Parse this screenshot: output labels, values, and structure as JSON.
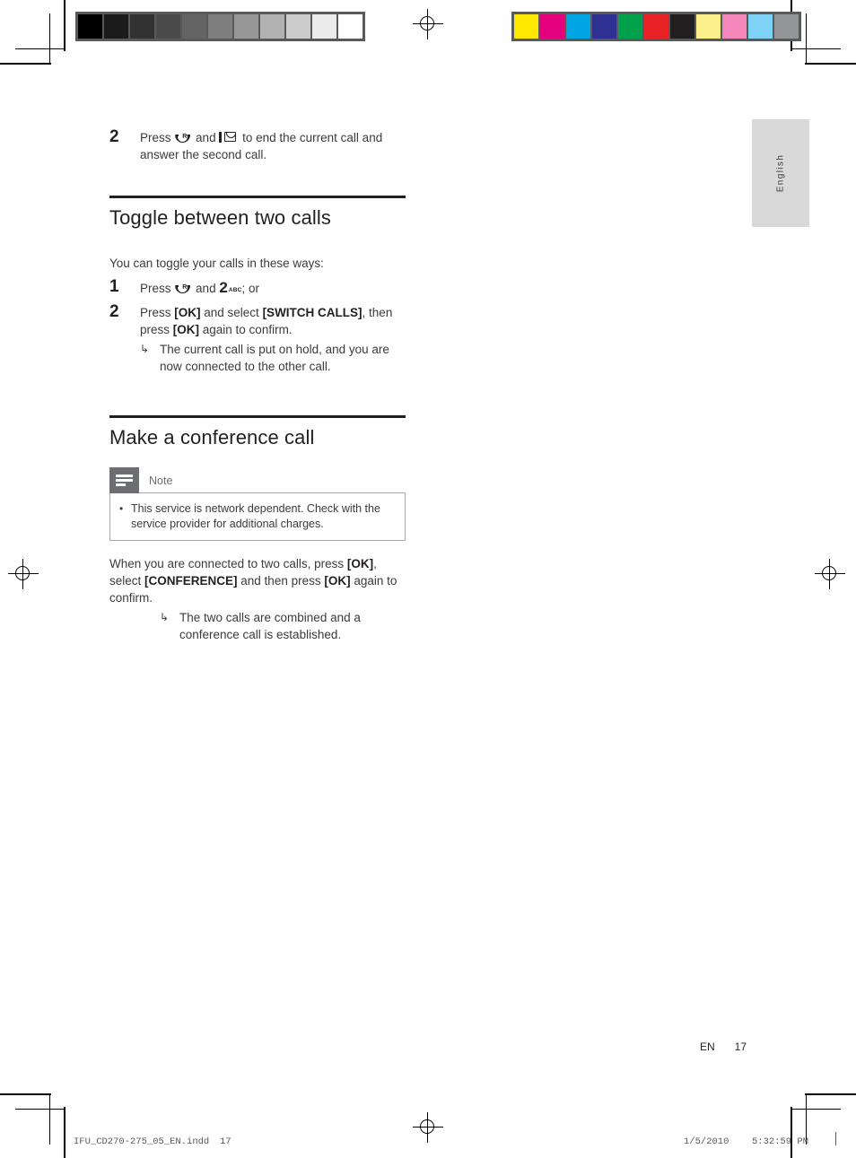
{
  "page": {
    "language_tab": "English",
    "footer": {
      "language_code": "EN",
      "page_number": "17"
    },
    "print_strip": {
      "filename": "IFU_CD270-275_05_EN.indd",
      "page_number": "17",
      "date": "1/5/2010",
      "time": "5:32:59 PM"
    }
  },
  "calibration": {
    "grayscale_label": "grayscale-calibration-bar",
    "color_label": "color-calibration-bar",
    "grayscale_swatches": [
      "#000000",
      "#1c1b1b",
      "#333232",
      "#4c4b4b",
      "#656464",
      "#7f7e7e",
      "#989797",
      "#b3b2b2",
      "#cdcccc",
      "#ebebeb",
      "#ffffff"
    ],
    "color_swatches": [
      "#fee800",
      "#e5007e",
      "#00a5e3",
      "#2e3192",
      "#00a14b",
      "#e92226",
      "#231f20",
      "#fbf08b",
      "#f486bc",
      "#7ed2f5",
      "#939598"
    ]
  },
  "content": {
    "step_continued": {
      "number": "2",
      "text_before": "Press",
      "text_middle": "and",
      "text_after": "to end the current call and answer the second call.",
      "icon_handset": "handset-recall-icon",
      "icon_endcall": "end-call-envelope-icon"
    },
    "section_toggle": {
      "heading": "Toggle between two calls",
      "intro": "You can toggle your calls in these ways:",
      "steps": [
        {
          "number": "1",
          "text_before": "Press",
          "text_middle": "and",
          "key_digit": "2",
          "key_letters": "ABC",
          "text_after": "; or"
        },
        {
          "number": "2",
          "segments": [
            {
              "text": "Press ",
              "bold": false
            },
            {
              "text": "[OK]",
              "bold": true
            },
            {
              "text": " and select ",
              "bold": false
            },
            {
              "text": "[SWITCH CALLS]",
              "bold": true
            },
            {
              "text": ", then press ",
              "bold": false
            },
            {
              "text": "[OK]",
              "bold": true
            },
            {
              "text": " again to confirm.",
              "bold": false
            }
          ],
          "subnote": "The current call is put on hold, and you are now connected to the other call."
        }
      ]
    },
    "section_conference": {
      "heading": "Make a conference call",
      "note": {
        "label": "Note",
        "items": [
          "This service is network dependent. Check with the service provider for additional charges."
        ]
      },
      "body_segments": [
        {
          "text": "When you are connected to two calls, press ",
          "bold": false
        },
        {
          "text": "[OK]",
          "bold": true
        },
        {
          "text": ", select ",
          "bold": false
        },
        {
          "text": "[CONFERENCE]",
          "bold": true
        },
        {
          "text": " and then press ",
          "bold": false
        },
        {
          "text": "[OK]",
          "bold": true
        },
        {
          "text": " again to confirm.",
          "bold": false
        }
      ],
      "subnote": "The two calls are combined and a conference call is established.",
      "arrow_glyph": "↳"
    }
  }
}
